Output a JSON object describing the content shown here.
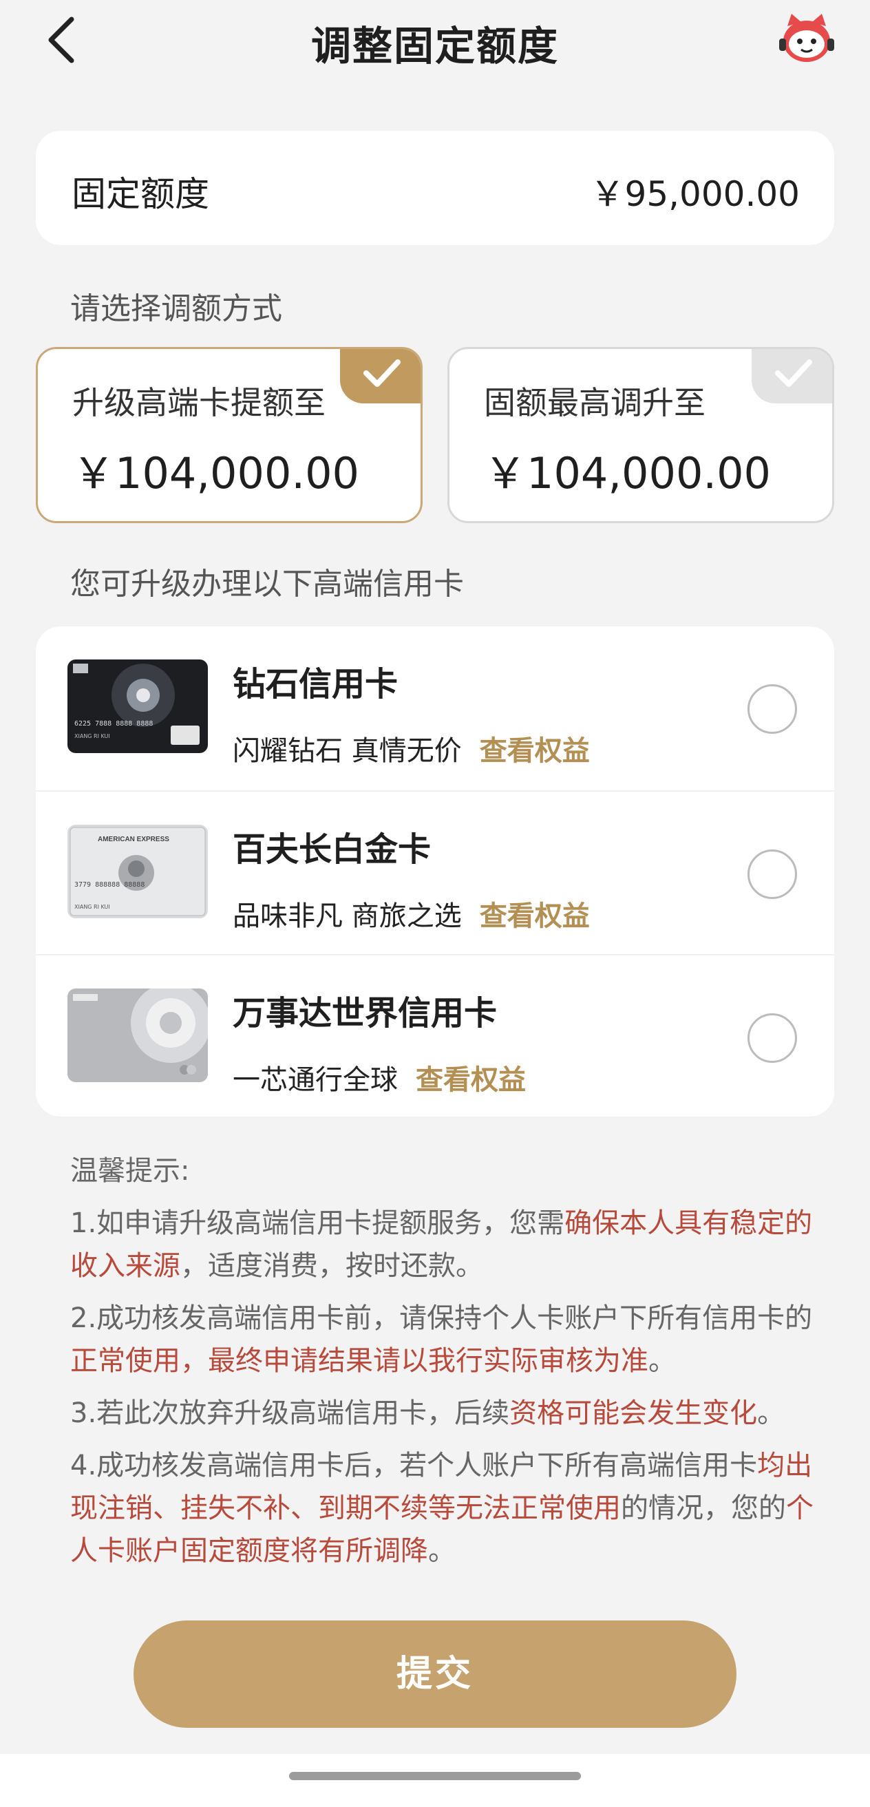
{
  "header": {
    "title": "调整固定额度"
  },
  "limit": {
    "label": "固定额度",
    "value": "￥95,000.00"
  },
  "method_section": {
    "label": "请选择调额方式"
  },
  "options": [
    {
      "label": "升级高端卡提额至",
      "value": "￥104,000.00",
      "selected": true
    },
    {
      "label": "固额最高调升至",
      "value": "￥104,000.00",
      "selected": false
    }
  ],
  "cards_section": {
    "label": "您可升级办理以下高端信用卡"
  },
  "cards": [
    {
      "name": "钻石信用卡",
      "desc": "闪耀钻石 真情无价",
      "link": "查看权益",
      "image": "diamond-card",
      "card_number": "6225 7888 8888 8888",
      "holder": "XIANG RI KUI"
    },
    {
      "name": "百夫长白金卡",
      "desc": "品味非凡 商旅之选",
      "link": "查看权益",
      "image": "amex-platinum-card",
      "brand": "AMERICAN EXPRESS",
      "card_number": "3779 888888 88888",
      "holder": "XIANG RI KUI"
    },
    {
      "name": "万事达世界信用卡",
      "desc": "一芯通行全球",
      "link": "查看权益",
      "image": "mastercard-world-card"
    }
  ],
  "tips": {
    "title": "温馨提示:",
    "items": [
      {
        "a": "1.如申请升级高端信用卡提额服务，您需",
        "b": "确保本人具有稳定的收入来源",
        "c": "，适度消费，按时还款。"
      },
      {
        "a": "2.成功核发高端信用卡前，请保持个人卡账户下所有信用卡的",
        "b": "正常使用，最终申请结果请以我行实际审核为准",
        "c": "。"
      },
      {
        "a": "3.若此次放弃升级高端信用卡，后续",
        "b": "资格可能会发生变化",
        "c": "。"
      },
      {
        "a": "4.成功核发高端信用卡后，若个人账户下所有高端信用卡",
        "b": "均出现注销、挂失不补、到期不续等无法正常使用",
        "c": "的情况，您的",
        "d": "个人卡账户固定额度将有所调降",
        "e": "。"
      }
    ]
  },
  "submit": {
    "label": "提交"
  },
  "colors": {
    "accent": "#c6a36e",
    "highlight": "#b84a3c",
    "background": "#f4f3f3"
  }
}
